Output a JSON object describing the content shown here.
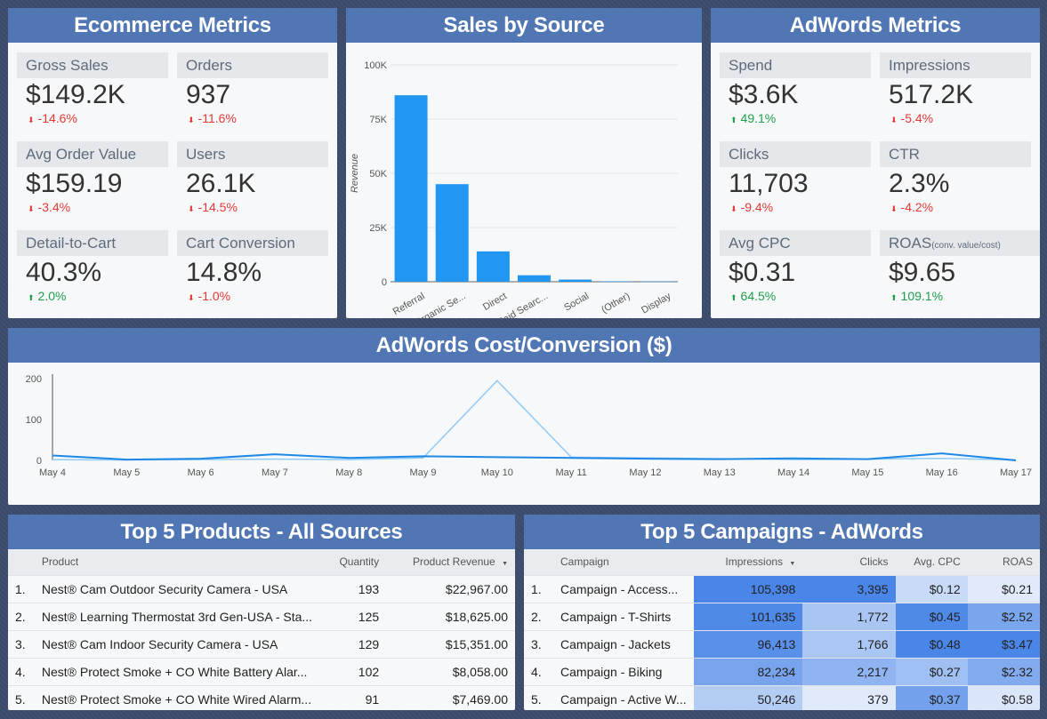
{
  "ecom": {
    "title": "Ecommerce Metrics",
    "tiles": [
      {
        "label": "Gross Sales",
        "value": "$149.2K",
        "delta": "-14.6%",
        "dir": "down"
      },
      {
        "label": "Orders",
        "value": "937",
        "delta": "-11.6%",
        "dir": "down"
      },
      {
        "label": "Avg Order Value",
        "value": "$159.19",
        "delta": "-3.4%",
        "dir": "down"
      },
      {
        "label": "Users",
        "value": "26.1K",
        "delta": "-14.5%",
        "dir": "down"
      },
      {
        "label": "Detail-to-Cart",
        "value": "40.3%",
        "delta": "2.0%",
        "dir": "up"
      },
      {
        "label": "Cart Conversion",
        "value": "14.8%",
        "delta": "-1.0%",
        "dir": "down"
      }
    ]
  },
  "adwords": {
    "title": "AdWords Metrics",
    "tiles": [
      {
        "label": "Spend",
        "value": "$3.6K",
        "delta": "49.1%",
        "dir": "up"
      },
      {
        "label": "Impressions",
        "value": "517.2K",
        "delta": "-5.4%",
        "dir": "down"
      },
      {
        "label": "Clicks",
        "value": "11,703",
        "delta": "-9.4%",
        "dir": "down"
      },
      {
        "label": "CTR",
        "value": "2.3%",
        "delta": "-4.2%",
        "dir": "down"
      },
      {
        "label": "Avg CPC",
        "value": "$0.31",
        "delta": "64.5%",
        "dir": "up"
      },
      {
        "label": "ROAS",
        "label_note": "(conv. value/cost)",
        "value": "$9.65",
        "delta": "109.1%",
        "dir": "up"
      }
    ]
  },
  "arrows": {
    "up": "⬆",
    "down": "⬇"
  },
  "chart_data": [
    {
      "type": "bar",
      "title": "Sales by Source",
      "ylabel": "Revenue",
      "categories": [
        "Referral",
        "Organic Se...",
        "Direct",
        "Paid Searc...",
        "Social",
        "(Other)",
        "Display"
      ],
      "values": [
        86000,
        45000,
        14000,
        3000,
        1000,
        200,
        100
      ],
      "ylim": [
        0,
        100000
      ],
      "yticks": [
        "0",
        "25K",
        "50K",
        "75K",
        "100K"
      ],
      "color": "#2196f3"
    },
    {
      "type": "line",
      "title": "AdWords Cost/Conversion ($)",
      "x": [
        "May 4",
        "May 5",
        "May 6",
        "May 7",
        "May 8",
        "May 9",
        "May 10",
        "May 11",
        "May 12",
        "May 13",
        "May 14",
        "May 15",
        "May 16",
        "May 17"
      ],
      "ylim": [
        0,
        200
      ],
      "yticks": [
        "0",
        "100",
        "200"
      ],
      "series": [
        {
          "values": [
            12,
            2,
            4,
            15,
            6,
            10,
            8,
            6,
            4,
            3,
            5,
            3,
            17,
            0
          ],
          "color": "#1e88e5"
        },
        {
          "values": [
            2,
            1,
            2,
            3,
            2,
            6,
            195,
            8,
            6,
            4,
            2,
            3,
            5,
            1
          ],
          "color": "#90caf9"
        }
      ]
    }
  ],
  "products": {
    "title": "Top 5 Products - All Sources",
    "headers": [
      "Product",
      "Quantity",
      "Product Revenue"
    ],
    "sort_icon": "▼",
    "rows": [
      {
        "i": "1.",
        "name": "Nest® Cam Outdoor Security Camera - USA",
        "qty": "193",
        "rev": "$22,967.00"
      },
      {
        "i": "2.",
        "name": "Nest® Learning Thermostat 3rd Gen-USA - Sta...",
        "qty": "125",
        "rev": "$18,625.00"
      },
      {
        "i": "3.",
        "name": "Nest® Cam Indoor Security Camera - USA",
        "qty": "129",
        "rev": "$15,351.00"
      },
      {
        "i": "4.",
        "name": "Nest® Protect Smoke + CO White Battery Alar...",
        "qty": "102",
        "rev": "$8,058.00"
      },
      {
        "i": "5.",
        "name": "Nest® Protect Smoke + CO White Wired Alarm...",
        "qty": "91",
        "rev": "$7,469.00"
      }
    ]
  },
  "campaigns": {
    "title": "Top 5 Campaigns - AdWords",
    "headers": [
      "Campaign",
      "Impressions",
      "Clicks",
      "Avg. CPC",
      "ROAS"
    ],
    "sort_icon": "▼",
    "rows": [
      {
        "i": "1.",
        "name": "Campaign - Access...",
        "imp": "105,398",
        "clicks": "3,395",
        "cpc": "$0.12",
        "roas": "$0.21",
        "c": [
          "#4a86e8",
          "#4a86e8",
          "#c9daf8",
          "#e1eafb"
        ]
      },
      {
        "i": "2.",
        "name": "Campaign - T-Shirts",
        "imp": "101,635",
        "clicks": "1,772",
        "cpc": "$0.45",
        "roas": "$2.52",
        "c": [
          "#4f8ae9",
          "#a9c5f4",
          "#4f8ae9",
          "#7aa6ee"
        ]
      },
      {
        "i": "3.",
        "name": "Campaign - Jackets",
        "imp": "96,413",
        "clicks": "1,766",
        "cpc": "$0.48",
        "roas": "$3.47",
        "c": [
          "#5990ea",
          "#aac6f4",
          "#4a86e8",
          "#4a86e8"
        ]
      },
      {
        "i": "4.",
        "name": "Campaign - Biking",
        "imp": "82,234",
        "clicks": "2,217",
        "cpc": "$0.27",
        "roas": "$2.32",
        "c": [
          "#78a4ee",
          "#8fb4f1",
          "#a0bff3",
          "#82aaef"
        ]
      },
      {
        "i": "5.",
        "name": "Campaign - Active W...",
        "imp": "50,246",
        "clicks": "379",
        "cpc": "$0.37",
        "roas": "$0.58",
        "c": [
          "#b4cdf5",
          "#e1eafb",
          "#74a1ed",
          "#dbe6fa"
        ]
      }
    ]
  }
}
